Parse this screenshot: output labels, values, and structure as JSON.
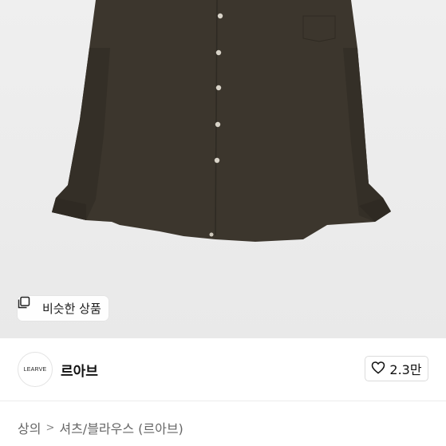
{
  "product_image": {
    "alt_icon": "shirt-image",
    "background": "#ebebeb",
    "garment_color": "#3b352c"
  },
  "similar_products": {
    "label": "비슷한 상품",
    "icon": "similar-stack-icon"
  },
  "shop": {
    "logo_text": "LEARVE",
    "name": "르아브"
  },
  "like": {
    "icon": "heart-icon",
    "count": "2.3만"
  },
  "breadcrumb": {
    "level1": "상의",
    "separator": ">",
    "level2": "셔츠/블라우스 (르아브)"
  }
}
